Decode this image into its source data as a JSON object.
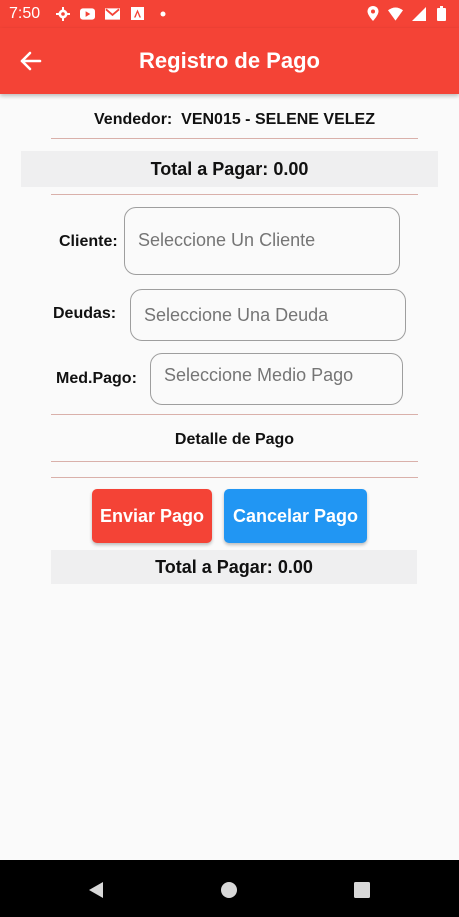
{
  "status": {
    "time": "7:50",
    "left_icons": [
      "gear-icon",
      "youtube-icon",
      "gmail-icon",
      "a-app-icon",
      "dot-icon"
    ],
    "right_icons": [
      "location-icon",
      "wifi-icon",
      "signal-icon",
      "battery-icon"
    ]
  },
  "appbar": {
    "title": "Registro de Pago",
    "back_icon": "arrow-back-icon"
  },
  "vendedor": {
    "label": "Vendedor:",
    "value": "VEN015 - SELENE VELEZ"
  },
  "total_top": {
    "label": "Total a Pagar:",
    "value": "0.00"
  },
  "form": {
    "cliente": {
      "label": "Cliente:",
      "placeholder": "Seleccione Un Cliente"
    },
    "deudas": {
      "label": "Deudas:",
      "placeholder": "Seleccione Una Deuda"
    },
    "medio": {
      "label": "Med.Pago:",
      "placeholder": "Seleccione Medio Pago"
    }
  },
  "detalle_title": "Detalle de Pago",
  "buttons": {
    "send": "Enviar Pago",
    "cancel": "Cancelar Pago"
  },
  "total_bottom": {
    "label": "Total a Pagar:",
    "value": "0.00"
  },
  "colors": {
    "primary": "#f44336",
    "accent": "#2196f3",
    "background": "#fafafa"
  },
  "nav": [
    "back-triangle-icon",
    "home-circle-icon",
    "recents-square-icon"
  ]
}
